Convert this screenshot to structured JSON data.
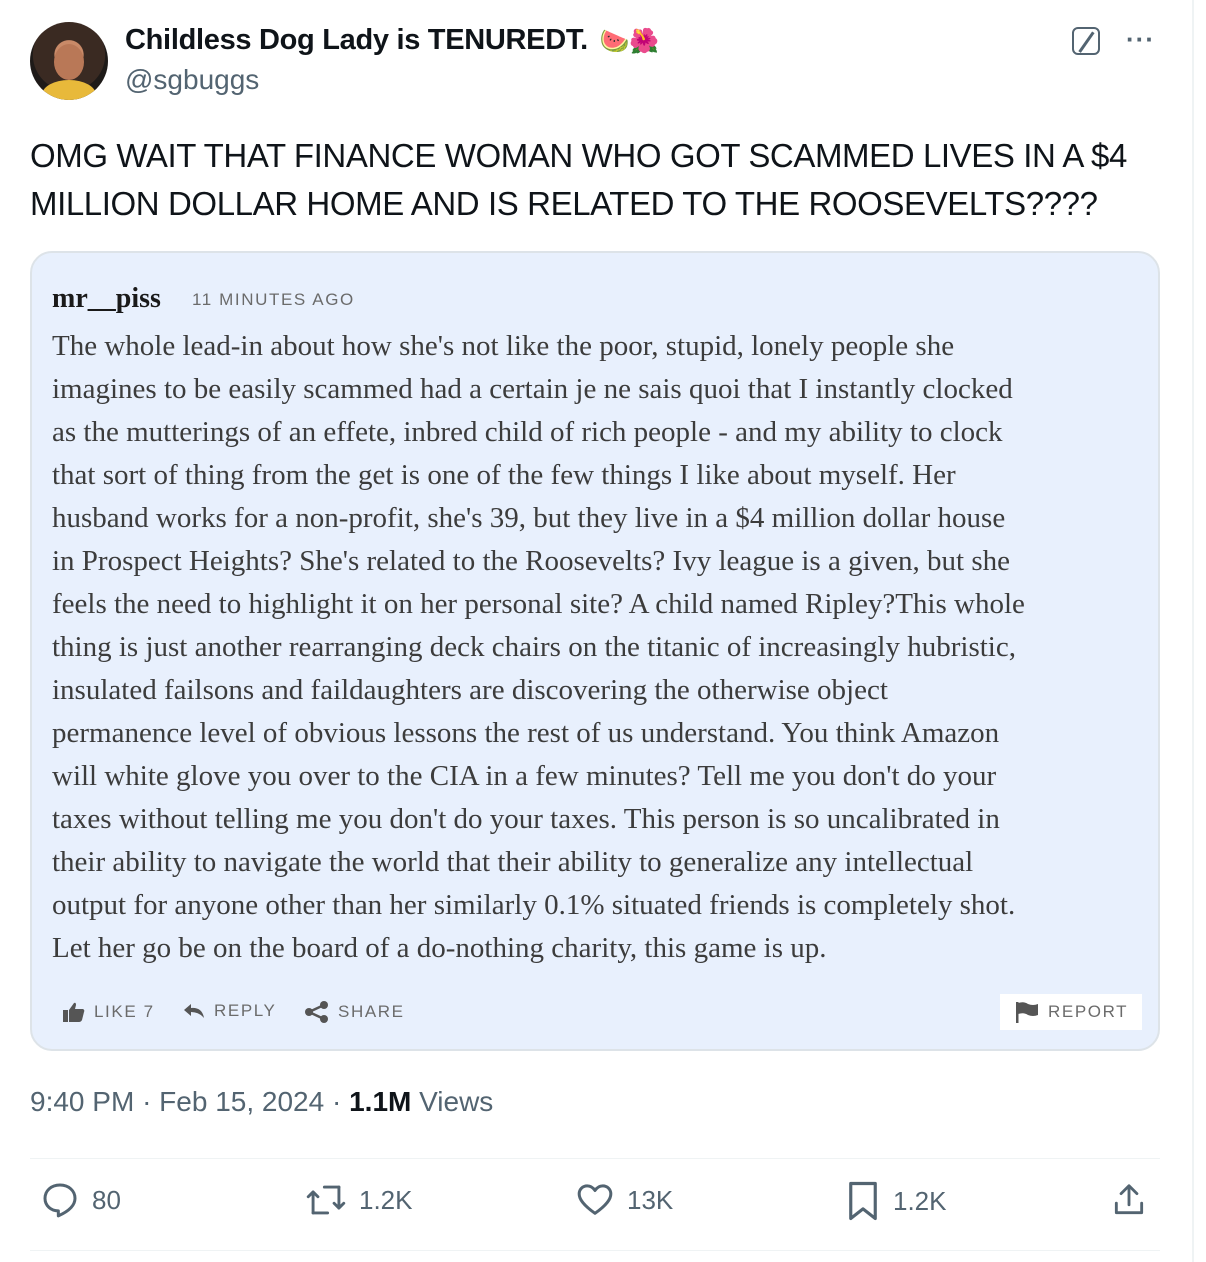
{
  "author": {
    "display_name": "Childless Dog Lady is TENUREDT.",
    "emoji": "🍉🌺",
    "handle": "@sgbuggs"
  },
  "tweet_text": "OMG WAIT THAT FINANCE WOMAN WHO GOT SCAMMED LIVES IN A $4 MILLION DOLLAR HOME AND IS RELATED TO THE ROOSEVELTS????",
  "quoted_comment": {
    "username": "mr__piss",
    "time": "11 MINUTES AGO",
    "lines": [
      "The whole lead-in about how she's not like the poor, stupid, lonely people she",
      "imagines to be easily scammed had a certain je ne sais quoi that I instantly clocked",
      "as the mutterings of an effete, inbred child of rich people - and my ability to clock",
      "that sort of thing from the get is one of the few things I like about myself. Her",
      "husband works for a non-profit, she's 39, but they live in a $4 million dollar house",
      "in Prospect Heights? She's related to the Roosevelts? Ivy league is a given, but she",
      "feels the need to highlight it on her personal site? A child named Ripley?This whole",
      "thing is just another rearranging deck chairs on the titanic of increasingly hubristic,",
      "insulated failsons and faildaughters are discovering the otherwise object",
      "permanence level of obvious lessons the rest of us understand. You think Amazon",
      "will white glove you over to the CIA in a few minutes? Tell me you don't do your",
      "taxes without telling me you don't do your taxes. This person is so uncalibrated in",
      "their ability to navigate the world that their ability to generalize any intellectual",
      "output for anyone other than her similarly 0.1% situated friends is completely shot.",
      "Let her go be on the board of a do-nothing charity, this game is up."
    ],
    "like_label": "LIKE 7",
    "reply_label": "REPLY",
    "share_label": "SHARE",
    "report_label": "REPORT"
  },
  "meta": {
    "time": "9:40 PM",
    "date": "Feb 15, 2024",
    "views_count": "1.1M",
    "views_label": "Views"
  },
  "actions": {
    "replies": "80",
    "reposts": "1.2K",
    "likes": "13K",
    "bookmarks": "1.2K"
  }
}
